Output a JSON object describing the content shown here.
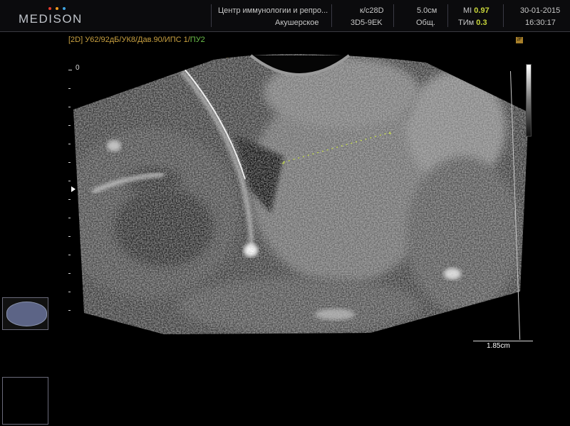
{
  "header": {
    "logo_text": "MEDISON",
    "logo_dot_colors": [
      "#e63b2e",
      "#f39a1e",
      "#3fa4e0"
    ],
    "institution": "Центр иммунологии и репро...",
    "study": "Акушерское",
    "probe": "к/с28D",
    "preset": "3D5-9EK",
    "depth": "5.0см",
    "mode": "Общ.",
    "mi_label": "MI",
    "mi_value": "0.97",
    "tim_label": "ТИм",
    "tim_value": "0.3",
    "date": "30-01-2015",
    "time": "16:30:17"
  },
  "params": {
    "mode_tag": "[2D]",
    "settings": "У62/92дБ/УК8/Дав.90/ИПС 1/",
    "setting_green": "ПУ2"
  },
  "scale": {
    "zero_label": "0"
  },
  "measurement": {
    "value": "1.85cm"
  },
  "indicators": {
    "r_badge": "2F"
  },
  "colors": {
    "accent_yellow": "#c8d63a",
    "param_orange": "#c8a040",
    "param_green": "#6cc04a"
  }
}
